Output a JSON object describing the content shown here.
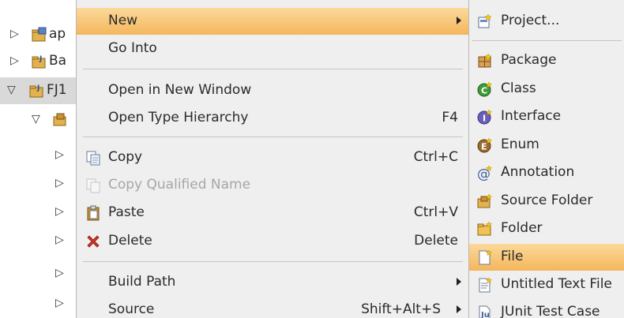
{
  "tree": {
    "rows": [
      {
        "label": "ap"
      },
      {
        "label": "Ba"
      },
      {
        "label": "FJ1"
      }
    ]
  },
  "menu": {
    "new": {
      "label": "New"
    },
    "go_into": {
      "label": "Go Into"
    },
    "open_new_window": {
      "label": "Open in New Window"
    },
    "open_type_hierarchy": {
      "label": "Open Type Hierarchy",
      "accel": "F4"
    },
    "copy": {
      "label": "Copy",
      "accel": "Ctrl+C"
    },
    "copy_qualified": {
      "label": "Copy Qualified Name"
    },
    "paste": {
      "label": "Paste",
      "accel": "Ctrl+V"
    },
    "delete": {
      "label": "Delete",
      "accel": "Delete"
    },
    "build_path": {
      "label": "Build Path"
    },
    "source": {
      "label": "Source",
      "accel": "Shift+Alt+S"
    }
  },
  "submenu": {
    "items": [
      {
        "label": "Project..."
      },
      {
        "label": "Package"
      },
      {
        "label": "Class"
      },
      {
        "label": "Interface"
      },
      {
        "label": "Enum"
      },
      {
        "label": "Annotation"
      },
      {
        "label": "Source Folder"
      },
      {
        "label": "Folder"
      },
      {
        "label": "File"
      },
      {
        "label": "Untitled Text File"
      },
      {
        "label": "JUnit Test Case"
      }
    ]
  },
  "colors": {
    "highlight": "#f6c36f",
    "menu_bg": "#efefef",
    "disabled_text": "#a6a6a6",
    "class_icon": "#3f9a3a",
    "interface_icon": "#6a5fb8",
    "enum_icon": "#9a6b2e",
    "delete_icon": "#d2342a"
  }
}
